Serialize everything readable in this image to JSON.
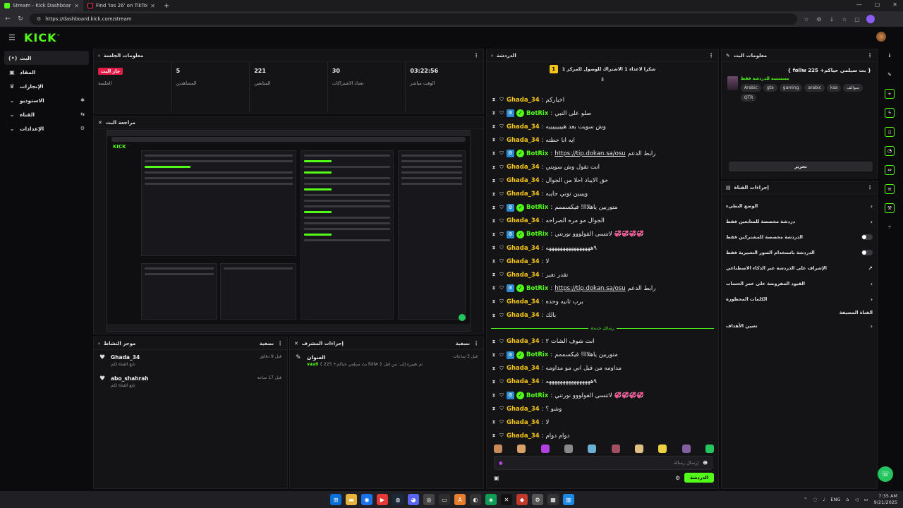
{
  "browser": {
    "tabs": [
      {
        "title": "Stream - Kick Dashboard",
        "active": true,
        "color": "#53fc18"
      },
      {
        "title": "Find 'ios 26' on TikTok | TikTok Se",
        "active": false,
        "color": "#111111"
      }
    ],
    "url": "https://dashboard.kick.com/stream"
  },
  "header": {
    "logo": "KICK"
  },
  "sidebar": {
    "items": [
      {
        "label": "البث",
        "icon": "live-icon",
        "glyph": "((•))",
        "active": true
      },
      {
        "label": "المقاد",
        "icon": "video-icon",
        "glyph": "▣"
      },
      {
        "label": "الإنجازات",
        "icon": "trophy-icon",
        "glyph": "🏆"
      },
      {
        "label": "الاستوديو",
        "icon": "chevron-down-icon",
        "glyph": "⌄",
        "trail": "✱"
      },
      {
        "label": "القناة",
        "icon": "chevron-down-icon",
        "glyph": "⌄",
        "trail": "⇆"
      },
      {
        "label": "الإعدادات",
        "icon": "chevron-down-icon",
        "glyph": "⌄",
        "trail": "⚙"
      }
    ]
  },
  "session": {
    "title": "معلومات الجلسة",
    "live_badge": "جار البث",
    "stats": [
      {
        "value": "",
        "caption": "الجلسة"
      },
      {
        "value": "5",
        "caption": "المشاهدين"
      },
      {
        "value": "221",
        "caption": "المتابعين"
      },
      {
        "value": "30",
        "caption": "تعداد الاشتراكات"
      },
      {
        "value": "03:22:56",
        "caption": "الوقت مباشر"
      }
    ]
  },
  "preview": {
    "title": "مراجعة البث"
  },
  "activity": {
    "title": "موجز النشاط",
    "filter": "تصفية",
    "items": [
      {
        "name": "Ghada_34",
        "sub": "تابع القناة لكم",
        "time": "قبل 9 دقائق"
      },
      {
        "name": "abo_shahrah",
        "sub": "تابع القناة لكم",
        "time": "قبل 17 ساعة"
      }
    ]
  },
  "mod": {
    "title": "إجراءات المشرف",
    "filter": "تصفية",
    "items": [
      {
        "name": "العنوان",
        "sub_user": "vaa9",
        "sub_text": "{ بث سيلمي حياكم+ 225 follw } تم تغييره إلى: من قبل",
        "time": "قبل 3 ساعات"
      }
    ]
  },
  "chat": {
    "title": "الدردشة",
    "pinned": "شكرا لاعداء 1 الاشتراك للوصول للمركز 1",
    "pin_number": "1",
    "messages": [
      {
        "user": "Ghada_34",
        "text": "اخباركم"
      },
      {
        "user": "BotRix",
        "bot": true,
        "text": "صلو على النبي"
      },
      {
        "user": "Ghada_34",
        "text": "وش سويت بعد هييييييييه"
      },
      {
        "user": "Ghada_34",
        "text": "ايه انا حطته"
      },
      {
        "user": "BotRix",
        "bot": true,
        "link": "https://tip.dokan.sa/osu",
        "text": "رابط الدعم"
      },
      {
        "user": "Ghada_34",
        "text": "انت تقول وش سويتي"
      },
      {
        "user": "Ghada_34",
        "text": "حق الايباد احلا من الجوال"
      },
      {
        "user": "Ghada_34",
        "text": "ويييين توني جايبه"
      },
      {
        "user": "BotRix",
        "bot": true,
        "text": "متوربين ياهلااا! فيكسممم"
      },
      {
        "user": "Ghada_34",
        "text": "الجوال مو مره الصراحه"
      },
      {
        "user": "BotRix",
        "bot": true,
        "text": "لاتنسى الفولووو نورتني 💞💞💞💞"
      },
      {
        "user": "Ghada_34",
        "text": "٩ههههههههههههههههه"
      },
      {
        "user": "Ghada_34",
        "text": "لا"
      },
      {
        "user": "Ghada_34",
        "text": "تقدر تغير"
      },
      {
        "user": "BotRix",
        "bot": true,
        "link": "https://tip.dokan.sa/osu",
        "text": "رابط الدعم"
      },
      {
        "user": "Ghada_34",
        "text": "برب ثانيه وحده"
      },
      {
        "user": "Ghada_34",
        "text": "بالك"
      }
    ],
    "new_messages_label": "رسائل جديدة",
    "new_messages": [
      {
        "user": "Ghada_34",
        "text": "انت شوف الشات ٢"
      },
      {
        "user": "BotRix",
        "bot": true,
        "text": "متوربين ياهلااا! فيكسممم"
      },
      {
        "user": "Ghada_34",
        "text": "مداومه من قبل اني مو مداومه"
      },
      {
        "user": "Ghada_34",
        "text": "٩ههههههههههههههههه"
      },
      {
        "user": "BotRix",
        "bot": true,
        "text": "لاتنسى الفولووو نورتني 💞💞💞💞"
      },
      {
        "user": "Ghada_34",
        "text": "وشو ؟"
      },
      {
        "user": "Ghada_34",
        "text": "لا"
      },
      {
        "user": "Ghada_34",
        "text": "دوام دوام"
      }
    ],
    "input_placeholder": "إرسال رسالة",
    "send_label": "الدردشة"
  },
  "stream_info": {
    "title": "معلومات البث",
    "stream_title": "{ بث سيلمي حياكم+ 225 follw }",
    "category": "مسسسه للدردشة فقط",
    "tags": [
      "Arabic",
      "gta",
      "gaming",
      "arabic",
      "ksa",
      "سوالف",
      "QTR"
    ],
    "edit_label": "تحرير"
  },
  "channel_actions": {
    "title": "إجراءات القناة",
    "items": [
      {
        "label": "الوضع البطيء",
        "kind": "arrow"
      },
      {
        "label": "دردشة مخصصة للمتابعين فقط",
        "kind": "arrow"
      },
      {
        "label": "الدردشة مخصصة للمشتركين فقط",
        "kind": "toggle"
      },
      {
        "label": "الدردشة باستخدام الصور التعبيرية فقط",
        "kind": "toggle"
      },
      {
        "label": "الإشراف على الدردشة عبر الذكاء الاصطناعي",
        "kind": "ext"
      },
      {
        "label": "القيود المفروضة على عمر الحساب",
        "kind": "arrow"
      },
      {
        "label": "الكلمات المحظورة",
        "kind": "arrow"
      }
    ],
    "section_label": "القناة المضيفة",
    "host_item": "تعيين الأهداف"
  },
  "taskbar": {
    "lang": "ENG",
    "time": "7:35 AM",
    "date": "9/21/2025"
  }
}
